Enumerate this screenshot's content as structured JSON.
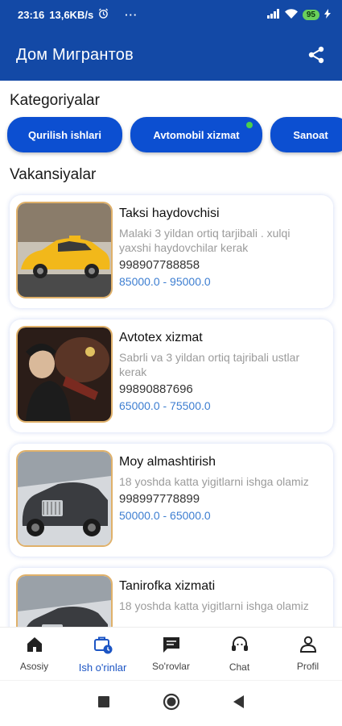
{
  "status_bar": {
    "time": "23:16",
    "speed": "13,6KB/s",
    "dots": "···",
    "battery": "95",
    "icons": [
      "alarm-icon",
      "signal-icon",
      "wifi-icon",
      "battery-icon",
      "charging-icon"
    ]
  },
  "app_bar": {
    "title": "Дом Мигрантов",
    "share_icon": "share-icon",
    "color": "#1349a6"
  },
  "categories": {
    "title": "Kategoriyalar",
    "items": [
      {
        "label": "Qurilish ishlari"
      },
      {
        "label": "Avtomobil xizmat"
      },
      {
        "label": "Sanoat"
      }
    ],
    "chip_color": "#0c4fd1"
  },
  "vacancies": {
    "title": "Vakansiyalar",
    "items": [
      {
        "title": "Taksi haydovchisi",
        "description": "Malaki 3 yildan ortiq tarjibali . xulqi yaxshi haydovchilar kerak",
        "phone": "998907788858",
        "salary": "85000.0 - 95000.0"
      },
      {
        "title": "Avtotex xizmat",
        "description": "Sabrli va 3 yildan ortiq tajribali ustlar kerak",
        "phone": "99890887696",
        "salary": "65000.0 - 75500.0"
      },
      {
        "title": "Moy almashtirish",
        "description": "18 yoshda katta yigitlarni ishga olamiz",
        "phone": "998997778899",
        "salary": "50000.0 - 65000.0"
      },
      {
        "title": "Tanirofka xizmati",
        "description": "18 yoshda katta yigitlarni ishga olamiz",
        "phone": "",
        "salary": ""
      }
    ],
    "salary_color": "#3d7ed1"
  },
  "bottom_nav": {
    "items": [
      {
        "label": "Asosiy",
        "icon": "home-icon"
      },
      {
        "label": "Ish o'rinlar",
        "icon": "briefcase-clock-icon"
      },
      {
        "label": "So'rovlar",
        "icon": "message-icon"
      },
      {
        "label": "Chat",
        "icon": "headset-icon"
      },
      {
        "label": "Profil",
        "icon": "person-icon"
      }
    ],
    "active_index": 1,
    "active_color": "#1c55c4"
  },
  "system_nav": {
    "icons": [
      "recents-icon",
      "home-circle-icon",
      "back-icon"
    ]
  }
}
